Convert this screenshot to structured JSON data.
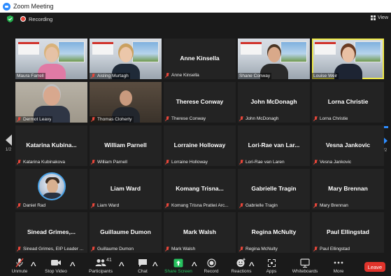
{
  "window": {
    "title": "Zoom Meeting"
  },
  "topbar": {
    "recording_label": "Recording",
    "view_label": "View"
  },
  "colors": {
    "accent": "#2d8cff",
    "recording": "#e8463a",
    "leave": "#e0332b",
    "active_speaker": "#f0ea4a",
    "share_screen": "#27c25f"
  },
  "pagination": {
    "left": "1/2",
    "right": "1/2"
  },
  "tiles": [
    {
      "label": "Maura Farrell",
      "muted": false,
      "type": "video"
    },
    {
      "label": "Aisling Murtagh",
      "muted": true,
      "type": "video"
    },
    {
      "center_name": "Anne Kinsella",
      "label": "Anne Kinsella",
      "muted": true,
      "type": "name"
    },
    {
      "label": "Shane Conway",
      "muted": false,
      "type": "video"
    },
    {
      "label": "Louise Weir",
      "muted": false,
      "type": "video",
      "active": true
    },
    {
      "label": "Dermot Leavy",
      "muted": true,
      "type": "video"
    },
    {
      "label": "Thomas Cloherty",
      "muted": true,
      "type": "video"
    },
    {
      "center_name": "Therese Conway",
      "label": "Therese Conway",
      "muted": true,
      "type": "name"
    },
    {
      "center_name": "John McDonagh",
      "label": "John McDonagh",
      "muted": true,
      "type": "name"
    },
    {
      "center_name": "Lorna Christie",
      "label": "Lorna Christie",
      "muted": true,
      "type": "name"
    },
    {
      "center_name": "Katarina Kubina...",
      "label": "Katarina Kubinakova",
      "muted": true,
      "type": "name"
    },
    {
      "center_name": "William Parnell",
      "label": "William Parnell",
      "muted": true,
      "type": "name"
    },
    {
      "center_name": "Lorraine Holloway",
      "label": "Lorraine Holloway",
      "muted": true,
      "type": "name"
    },
    {
      "center_name": "Lori-Rae van Lar...",
      "label": "Lori-Rae van Laren",
      "muted": true,
      "type": "name"
    },
    {
      "center_name": "Vesna Jankovic",
      "label": "Vesna Jankovic",
      "muted": true,
      "type": "name"
    },
    {
      "label": "Daniel Rad",
      "muted": true,
      "type": "avatar"
    },
    {
      "center_name": "Liam Ward",
      "label": "Liam Ward",
      "muted": true,
      "type": "name"
    },
    {
      "center_name": "Komang Trisna...",
      "label": "Komang Trisna Pratiwi Arc...",
      "muted": true,
      "type": "name"
    },
    {
      "center_name": "Gabrielle Tragin",
      "label": "Gabrielle Tragin",
      "muted": true,
      "type": "name"
    },
    {
      "center_name": "Mary Brennan",
      "label": "Mary Brennan",
      "muted": true,
      "type": "name"
    },
    {
      "center_name": "Sinead Grimes,...",
      "label": "Sinead Grimes, EIP Leader ...",
      "muted": true,
      "type": "name"
    },
    {
      "center_name": "Guillaume Dumon",
      "label": "Guillaume Dumon",
      "muted": true,
      "type": "name"
    },
    {
      "center_name": "Mark Walsh",
      "label": "Mark Walsh",
      "muted": true,
      "type": "name"
    },
    {
      "center_name": "Regina McNulty",
      "label": "Regina McNulty",
      "muted": true,
      "type": "name"
    },
    {
      "center_name": "Paul Ellingstad",
      "label": "Paul Ellingstad",
      "muted": true,
      "type": "name"
    }
  ],
  "toolbar": {
    "unmute": "Unmute",
    "stop_video": "Stop Video",
    "participants": "Participants",
    "participants_count": "41",
    "chat": "Chat",
    "share_screen": "Share Screen",
    "record": "Record",
    "reactions": "Reactions",
    "apps": "Apps",
    "whiteboards": "Whiteboards",
    "more": "More",
    "leave": "Leave"
  }
}
